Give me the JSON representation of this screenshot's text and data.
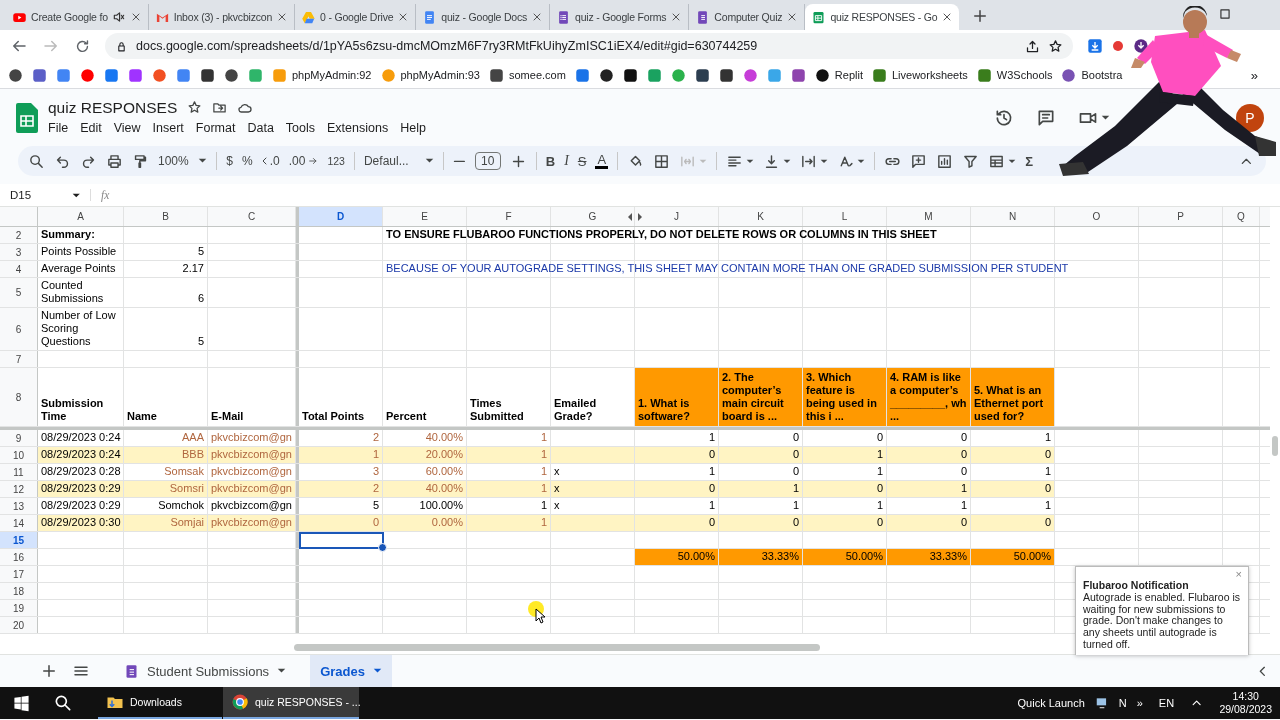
{
  "browser": {
    "tabs": [
      {
        "title": "Create Google fo",
        "selected": false,
        "audio": true
      },
      {
        "title": "Inbox (3) - pkvcbizcon",
        "selected": false,
        "audio": false
      },
      {
        "title": "0 - Google Drive",
        "selected": false,
        "audio": false
      },
      {
        "title": "quiz - Google Docs",
        "selected": false,
        "audio": false
      },
      {
        "title": "quiz - Google Forms",
        "selected": false,
        "audio": false
      },
      {
        "title": "Computer Quiz",
        "selected": false,
        "audio": false
      },
      {
        "title": "quiz RESPONSES - Go",
        "selected": true,
        "audio": false
      }
    ],
    "address": "docs.google.com/spreadsheets/d/1pYA5s6zsu-dmcMOmzM6F7ry3RMtFkUihyZmISC1iEX4/edit#gid=630744259",
    "bookmarks": [
      {
        "kind": "icon"
      },
      {
        "kind": "icon"
      },
      {
        "kind": "icon"
      },
      {
        "kind": "icon"
      },
      {
        "kind": "icon"
      },
      {
        "kind": "icon"
      },
      {
        "kind": "icon"
      },
      {
        "kind": "icon"
      },
      {
        "kind": "icon"
      },
      {
        "kind": "icon"
      },
      {
        "kind": "icon"
      },
      {
        "kind": "link",
        "label": "phpMyAdmin:92"
      },
      {
        "kind": "link",
        "label": "phpMyAdmin:93"
      },
      {
        "kind": "link",
        "label": "somee.com"
      },
      {
        "kind": "icon"
      },
      {
        "kind": "icon"
      },
      {
        "kind": "icon"
      },
      {
        "kind": "icon"
      },
      {
        "kind": "icon"
      },
      {
        "kind": "icon"
      },
      {
        "kind": "icon"
      },
      {
        "kind": "icon"
      },
      {
        "kind": "icon"
      },
      {
        "kind": "icon"
      },
      {
        "kind": "link",
        "label": "Replit"
      },
      {
        "kind": "link",
        "label": "Liveworksheets"
      },
      {
        "kind": "link",
        "label": "W3Schools"
      },
      {
        "kind": "link",
        "label": "Bootstra"
      }
    ],
    "more": "»"
  },
  "doc": {
    "title": "quiz RESPONSES",
    "menu": [
      "File",
      "Edit",
      "View",
      "Insert",
      "Format",
      "Data",
      "Tools",
      "Extensions",
      "Help"
    ],
    "avatar": "P"
  },
  "toolbar": {
    "zoom": "100%",
    "currency": "$",
    "percent": "%",
    "decrease_decimal": ".0",
    "increase_decimal": ".00",
    "number_format": "123",
    "font": "Defaul...",
    "font_size": "10",
    "bold": "B",
    "italic": "I",
    "strikethrough": "S",
    "text_color": "A",
    "functions": "Σ"
  },
  "formula_bar": {
    "name_box": "D15",
    "fx": "fx"
  },
  "sheet": {
    "columns": [
      {
        "letter": "A",
        "selected": false
      },
      {
        "letter": "B",
        "selected": false
      },
      {
        "letter": "C",
        "selected": false
      },
      {
        "letter": "D",
        "selected": true
      },
      {
        "letter": "E",
        "selected": false
      },
      {
        "letter": "F",
        "selected": false
      },
      {
        "letter": "G",
        "selected": false
      },
      {
        "letter": "J",
        "selected": false
      },
      {
        "letter": "K",
        "selected": false
      },
      {
        "letter": "L",
        "selected": false
      },
      {
        "letter": "M",
        "selected": false
      },
      {
        "letter": "N",
        "selected": false
      },
      {
        "letter": "O",
        "selected": false
      },
      {
        "letter": "P",
        "selected": false
      },
      {
        "letter": "Q",
        "selected": false
      }
    ],
    "rows": [
      {
        "number": "2",
        "kind": "title",
        "selected": false,
        "cells": {
          "A": "Summary:",
          "E": "TO ENSURE FLUBAROO FUNCTIONS PROPERLY, DO NOT DELETE ROWS OR COLUMNS IN THIS SHEET"
        }
      },
      {
        "number": "3",
        "kind": "summary",
        "selected": false,
        "cells": {
          "A": "Points Possible",
          "B": "5"
        }
      },
      {
        "number": "4",
        "kind": "note",
        "selected": false,
        "cells": {
          "A": "Average Points",
          "B": "2.17",
          "E": "BECAUSE OF YOUR AUTOGRADE SETTINGS, THIS SHEET MAY CONTAIN MORE THAN ONE GRADED SUBMISSION PER STUDENT"
        }
      },
      {
        "number": "5",
        "kind": "summary",
        "selected": false,
        "cells": {
          "A": "Counted Submissions",
          "B": "6"
        }
      },
      {
        "number": "6",
        "kind": "summary",
        "selected": false,
        "cells": {
          "A": "Number of Low Scoring Questions",
          "B": "5"
        }
      },
      {
        "number": "7",
        "kind": "blank",
        "selected": false,
        "cells": {}
      },
      {
        "number": "8",
        "kind": "header",
        "selected": false,
        "cells": {
          "A": "Submission Time",
          "B": "Name",
          "C": "E-Mail",
          "D": "Total Points",
          "E": "Percent",
          "F": "Times Submitted",
          "G": "Emailed Grade?",
          "J": "1. What is software?",
          "K": "2. The computer’s main circuit board is  ...",
          "L": "3. Which feature is being used in this i ...",
          "M": "4. RAM is like a computer’s _________, wh ...",
          "N": "5. What is an Ethernet port used for?"
        }
      },
      {
        "number": "9",
        "kind": "data",
        "selected": false,
        "highlighted": false,
        "flagged": true,
        "cells": {
          "A": "08/29/2023 0:24",
          "B": "AAA",
          "C": "pkvcbizcom@gn",
          "D": "2",
          "E": "40.00%",
          "F": "1",
          "J": "1",
          "K": "0",
          "L": "0",
          "M": "0",
          "N": "1"
        }
      },
      {
        "number": "10",
        "kind": "data",
        "selected": false,
        "highlighted": true,
        "flagged": true,
        "cells": {
          "A": "08/29/2023 0:24",
          "B": "BBB",
          "C": "pkvcbizcom@gn",
          "D": "1",
          "E": "20.00%",
          "F": "1",
          "J": "0",
          "K": "0",
          "L": "1",
          "M": "0",
          "N": "0"
        }
      },
      {
        "number": "11",
        "kind": "data",
        "selected": false,
        "highlighted": false,
        "flagged": true,
        "cells": {
          "A": "08/29/2023 0:28",
          "B": "Somsak",
          "C": "pkvcbizcom@gn",
          "D": "3",
          "E": "60.00%",
          "F": "1",
          "G": "x",
          "J": "1",
          "K": "0",
          "L": "1",
          "M": "0",
          "N": "1"
        }
      },
      {
        "number": "12",
        "kind": "data",
        "selected": false,
        "highlighted": true,
        "flagged": true,
        "cells": {
          "A": "08/29/2023 0:29",
          "B": "Somsri",
          "C": "pkvcbizcom@gn",
          "D": "2",
          "E": "40.00%",
          "F": "1",
          "G": "x",
          "J": "0",
          "K": "1",
          "L": "0",
          "M": "1",
          "N": "0"
        }
      },
      {
        "number": "13",
        "kind": "data",
        "selected": false,
        "highlighted": false,
        "flagged": false,
        "cells": {
          "A": "08/29/2023 0:29",
          "B": "Somchok",
          "C": "pkvcbizcom@gn",
          "D": "5",
          "E": "100.00%",
          "F": "1",
          "G": "x",
          "J": "1",
          "K": "1",
          "L": "1",
          "M": "1",
          "N": "1"
        }
      },
      {
        "number": "14",
        "kind": "data",
        "selected": false,
        "highlighted": true,
        "flagged": true,
        "cells": {
          "A": "08/29/2023 0:30",
          "B": "Somjai",
          "C": "pkvcbizcom@gn",
          "D": "0",
          "E": "0.00%",
          "F": "1",
          "J": "0",
          "K": "0",
          "L": "0",
          "M": "0",
          "N": "0"
        }
      },
      {
        "number": "15",
        "kind": "blank",
        "selected": true,
        "cells": {}
      },
      {
        "number": "16",
        "kind": "average",
        "selected": false,
        "cells": {
          "J": "50.00%",
          "K": "33.33%",
          "L": "50.00%",
          "M": "33.33%",
          "N": "50.00%"
        }
      },
      {
        "number": "17",
        "kind": "blank",
        "selected": false,
        "cells": {}
      },
      {
        "number": "18",
        "kind": "blank",
        "selected": false,
        "cells": {}
      },
      {
        "number": "19",
        "kind": "blank",
        "selected": false,
        "cells": {}
      },
      {
        "number": "20",
        "kind": "blank",
        "selected": false,
        "cells": {}
      }
    ]
  },
  "sheet_tabs": [
    {
      "label": "Student Submissions",
      "selected": false
    },
    {
      "label": "Grades",
      "selected": true
    }
  ],
  "notification": {
    "title": "Flubaroo Notification",
    "body": "Autograde is enabled. Flubaroo is waiting for new submissions to grade. Don't make changes to any sheets until autograde is turned off.",
    "close": "×"
  },
  "taskbar": {
    "items": [
      {
        "label": "Downloads",
        "selected": false
      },
      {
        "label": "quiz RESPONSES - ...",
        "selected": true
      }
    ],
    "quick_launch": "Quick Launch",
    "tray_letter": "N",
    "tray_more": "»",
    "language": "EN",
    "time": "14:30",
    "date": "29/08/2023"
  }
}
